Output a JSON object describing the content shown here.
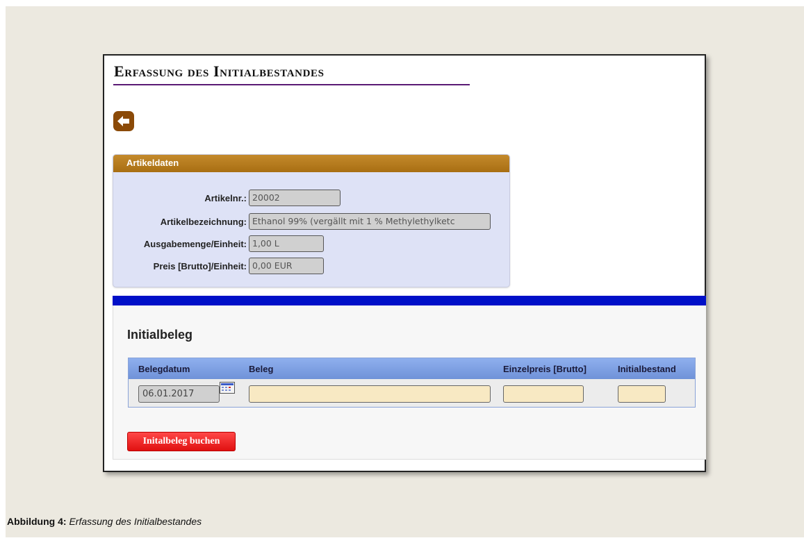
{
  "page": {
    "title": "Erfassung des Initialbestandes"
  },
  "artikel_panel": {
    "header": "Artikeldaten",
    "fields": [
      {
        "label": "Artikelnr.:",
        "value": "20002"
      },
      {
        "label": "Artikelbezeichnung:",
        "value": "Ethanol 99% (vergällt mit 1 % Methylethylketc"
      },
      {
        "label": "Ausgabemenge/Einheit:",
        "value": "1,00 L"
      },
      {
        "label": "Preis [Brutto]/Einheit:",
        "value": "0,00 EUR"
      }
    ]
  },
  "initialbeleg": {
    "title": "Initialbeleg",
    "columns": [
      "Belegdatum",
      "Beleg",
      "Einzelpreis [Brutto]",
      "Initialbestand"
    ],
    "row": {
      "belegdatum": "06.01.2017",
      "beleg": "",
      "einzelpreis": "",
      "initialbestand": ""
    },
    "submit_label": "Initalbeleg buchen"
  },
  "caption": {
    "prefix": "Abbildung 4:",
    "text": "Erfassung des Initialbestandes"
  },
  "colors": {
    "panel_header": "#b07a1c",
    "blue_bar": "#0010c8",
    "submit_button": "#f02020",
    "title_rule": "#5a1a74",
    "back_button": "#8b4a08"
  },
  "icons": {
    "back": "arrow-left-icon",
    "calendar": "calendar-icon"
  }
}
